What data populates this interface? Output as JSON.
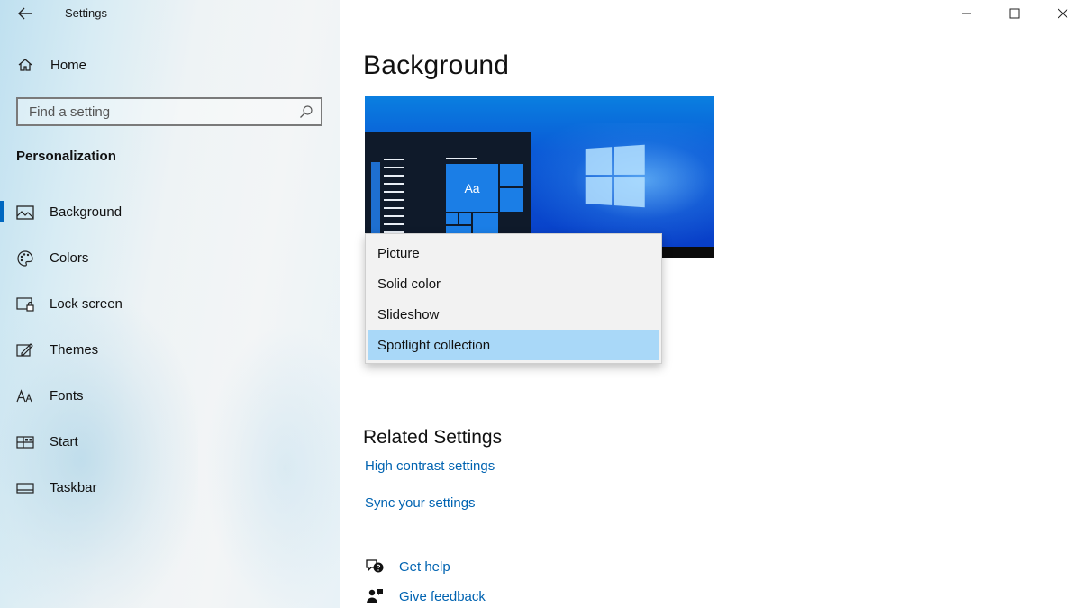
{
  "window": {
    "app_title": "Settings"
  },
  "sidebar": {
    "home_label": "Home",
    "search_placeholder": "Find a setting",
    "section_title": "Personalization",
    "items": [
      {
        "label": "Background",
        "icon": "image-icon",
        "active": true
      },
      {
        "label": "Colors",
        "icon": "palette-icon",
        "active": false
      },
      {
        "label": "Lock screen",
        "icon": "lock-screen-icon",
        "active": false
      },
      {
        "label": "Themes",
        "icon": "themes-icon",
        "active": false
      },
      {
        "label": "Fonts",
        "icon": "fonts-icon",
        "active": false
      },
      {
        "label": "Start",
        "icon": "start-icon",
        "active": false
      },
      {
        "label": "Taskbar",
        "icon": "taskbar-icon",
        "active": false
      }
    ]
  },
  "main": {
    "page_title": "Background",
    "preview_sample_text": "Aa",
    "dropdown": {
      "options": [
        "Picture",
        "Solid color",
        "Slideshow",
        "Spotlight collection"
      ],
      "selected": "Spotlight collection"
    },
    "related": {
      "title": "Related Settings",
      "links": [
        "High contrast settings",
        "Sync your settings"
      ]
    },
    "help": {
      "get_help": "Get help",
      "give_feedback": "Give feedback"
    }
  },
  "colors": {
    "accent": "#0067c0",
    "link": "#0063b1",
    "selection": "#a9d8f8"
  }
}
